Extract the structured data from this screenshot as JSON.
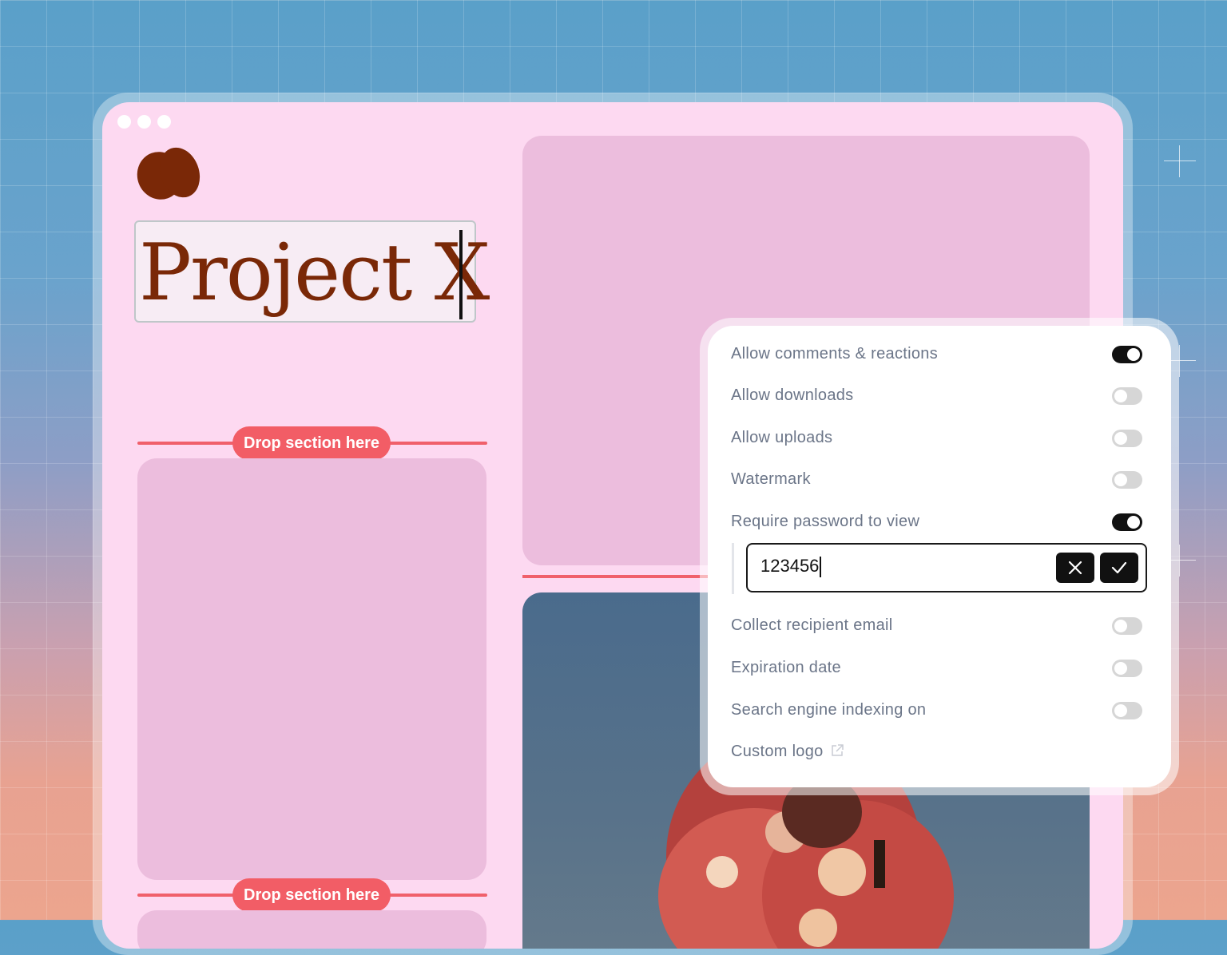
{
  "document": {
    "title": "Project X",
    "drop_labels": [
      "Drop section here",
      "Drop section here"
    ]
  },
  "settings": {
    "items": [
      {
        "label": "Allow comments & reactions",
        "enabled": true
      },
      {
        "label": "Allow downloads",
        "enabled": false
      },
      {
        "label": "Allow uploads",
        "enabled": false
      },
      {
        "label": "Watermark",
        "enabled": false
      },
      {
        "label": "Require password to view",
        "enabled": true
      },
      {
        "label": "Collect recipient email",
        "enabled": false
      },
      {
        "label": "Expiration date",
        "enabled": false
      },
      {
        "label": "Search engine indexing on",
        "enabled": false
      },
      {
        "label": "Custom logo"
      }
    ],
    "password_value": "123456"
  },
  "colors": {
    "accent": "#f25d66",
    "title_color": "#7a2807",
    "canvas": "#fdd9f1",
    "toggle_on": "#111111"
  },
  "icons": [
    "logo-blob-icon",
    "close-icon",
    "check-icon",
    "external-link-icon"
  ]
}
